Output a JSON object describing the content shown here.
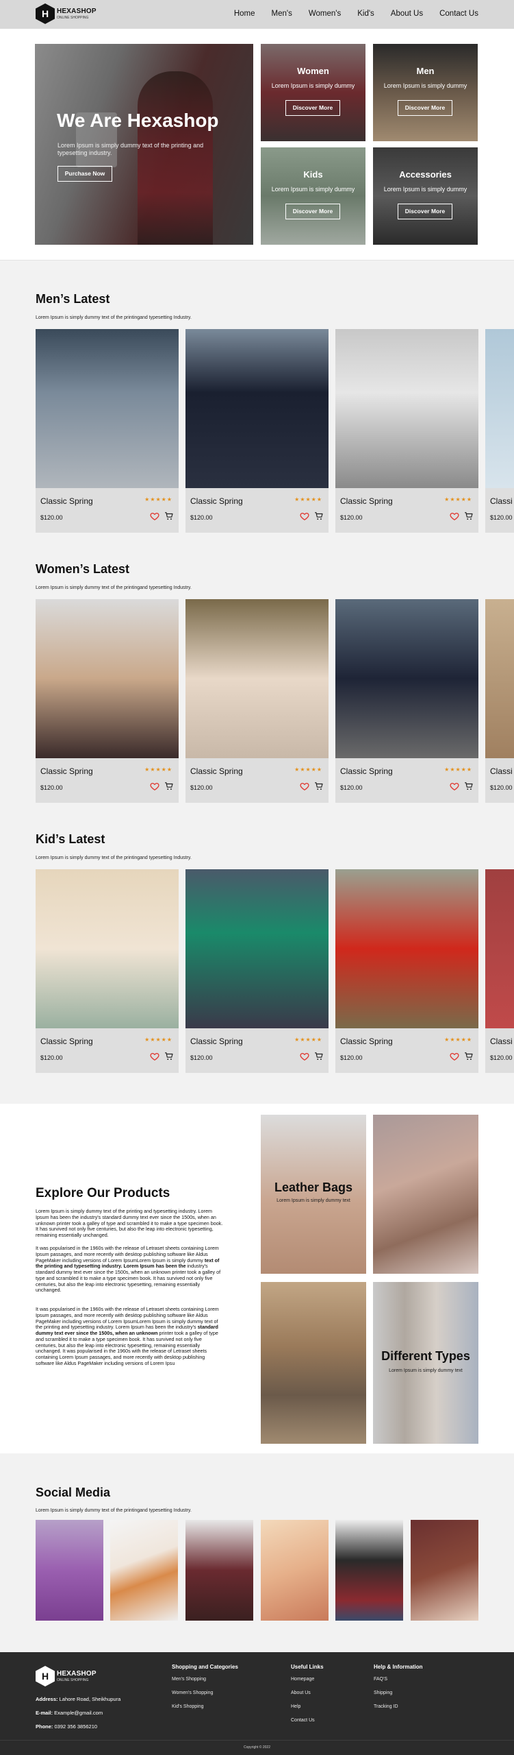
{
  "header": {
    "logo_letter": "H",
    "logo_title": "HEXASHOP",
    "logo_sub": "ONLINE SHOPPING",
    "nav": [
      "Home",
      "Men's",
      "Women's",
      "Kid's",
      "About Us",
      "Contact Us"
    ]
  },
  "hero": {
    "title": "We Are Hexashop",
    "text": "Lorem Ipsum is simply dummy text of the printing and typesetting industry.",
    "button": "Purchase Now",
    "tiles": [
      {
        "title": "Women",
        "sub": "Lorem Ipsum is simply dummy",
        "button": "Discover More"
      },
      {
        "title": "Men",
        "sub": "Lorem Ipsum is simply dummy",
        "button": "Discover More"
      },
      {
        "title": "Kids",
        "sub": "Lorem Ipsum is simply dummy",
        "button": "Discover More"
      },
      {
        "title": "Accessories",
        "sub": "Lorem Ipsum is simply dummy",
        "button": "Discover More"
      }
    ]
  },
  "mens": {
    "title": "Men’s Latest",
    "sub": "Lorem Ipsum is simply dummy text of the printingand typesetting Industry.",
    "products": [
      {
        "name": "Classic Spring",
        "price": "$120.00",
        "stars": "★★★★★"
      },
      {
        "name": "Classic Spring",
        "price": "$120.00",
        "stars": "★★★★★"
      },
      {
        "name": "Classic Spring",
        "price": "$120.00",
        "stars": "★★★★★"
      },
      {
        "name": "Classi",
        "price": "$120.00",
        "stars": ""
      }
    ]
  },
  "womens": {
    "title": "Women’s Latest",
    "sub": "Lorem Ipsum is simply dummy text of the printingand typesetting Industry.",
    "products": [
      {
        "name": "Classic Spring",
        "price": "$120.00",
        "stars": "★★★★★"
      },
      {
        "name": "Classic Spring",
        "price": "$120.00",
        "stars": "★★★★★"
      },
      {
        "name": "Classic Spring",
        "price": "$120.00",
        "stars": "★★★★★"
      },
      {
        "name": "Classi",
        "price": "$120.00",
        "stars": ""
      }
    ]
  },
  "kids": {
    "title": "Kid’s Latest",
    "sub": "Lorem Ipsum is simply dummy text of the printingand typesetting Industry.",
    "products": [
      {
        "name": "Classic Spring",
        "price": "$120.00",
        "stars": "★★★★★"
      },
      {
        "name": "Classic Spring",
        "price": "$120.00",
        "stars": "★★★★★"
      },
      {
        "name": "Classic Spring",
        "price": "$120.00",
        "stars": "★★★★★"
      },
      {
        "name": "Classi",
        "price": "$120.00",
        "stars": ""
      }
    ]
  },
  "explore": {
    "title": "Explore Our Products",
    "p1": "Lorem Ipsum is simply dummy text of the printing and typesetting industry. Lorem Ipsum has been the industry's standard dummy text ever since the 1500s, when an unknown printer took a galley of type and scrambled it to make a type specimen book. It has survived not only five centuries, but also the leap into electronic typesetting, remaining essentially unchanged.",
    "p2a": "It was popularised in the 1960s with the release of Letraset sheets containing Lorem Ipsum passages, and more recently with desktop publishing software like Aldus PageMaker including versions of Lorem IpsumLorem Ipsum is simply dummy ",
    "p2b": "text of the printing and typesetting industry. Lorem Ipsum has been the",
    "p2c": " industry's standard dummy text ever since the 1500s, when an unknown printer took a galley of type and scrambled it to make a type specimen book. It has survived not only five centuries, but also the leap into electronic typesetting, remaining essentially unchanged.",
    "p3a": "It was popularised in the 1960s with the release of Letraset sheets containing Lorem Ipsum passages, and more recently with desktop publishing software like Aldus PageMaker including versions of Lorem IpsumLorem Ipsum is simply dummy text of the printing and typesetting industry. Lorem Ipsum has been the industry's ",
    "p3b": "standard dummy text ever since the 1500s, when an unknown",
    "p3c": " printer took a galley of type and scrambled it to make a type specimen book. It has survived not only five centuries, but also the leap into electronic typesetting, remaining essentially unchanged. It was popularised in the 1960s with the release of Letraset sheets containing Lorem Ipsum passages, and more recently with desktop publishing software like Aldus PageMaker including versions of Lorem Ipsu",
    "bags_title": "Leather Bags",
    "bags_sub": "Lorem Ipsum is simply dummy text",
    "types_title": "Different Types",
    "types_sub": "Lorem Ipsum is simply dummy text"
  },
  "social": {
    "title": "Social Media",
    "sub": "Lorem Ipsum is simply dummy text of the printingand typesetting Industry."
  },
  "footer": {
    "logo_title": "HEXASHOP",
    "logo_sub": "ONLINE SHOPPING",
    "address_label": "Address:",
    "address": " Lahore Road, Sheikhupura",
    "email_label": "E-mail:",
    "email": " Example@gmail.com",
    "phone_label": "Phone:",
    "phone": " 0392 356 3856210",
    "col1_head": "Shopping and Categories",
    "col1": [
      "Men's Shopping",
      "Women's Shopping",
      "Kid's Shopping"
    ],
    "col2_head": "Useful Links",
    "col2": [
      "Homepage",
      "About Us",
      "Help",
      "Contact Us"
    ],
    "col3_head": "Help & Information",
    "col3": [
      "FAQ'S",
      "Shipping",
      "Tracking ID"
    ],
    "copyright": "Copyright © 2022"
  },
  "colors": {
    "star": "#e4901a",
    "heart": "#e0342c",
    "footer_bg": "#2b2b2b"
  }
}
